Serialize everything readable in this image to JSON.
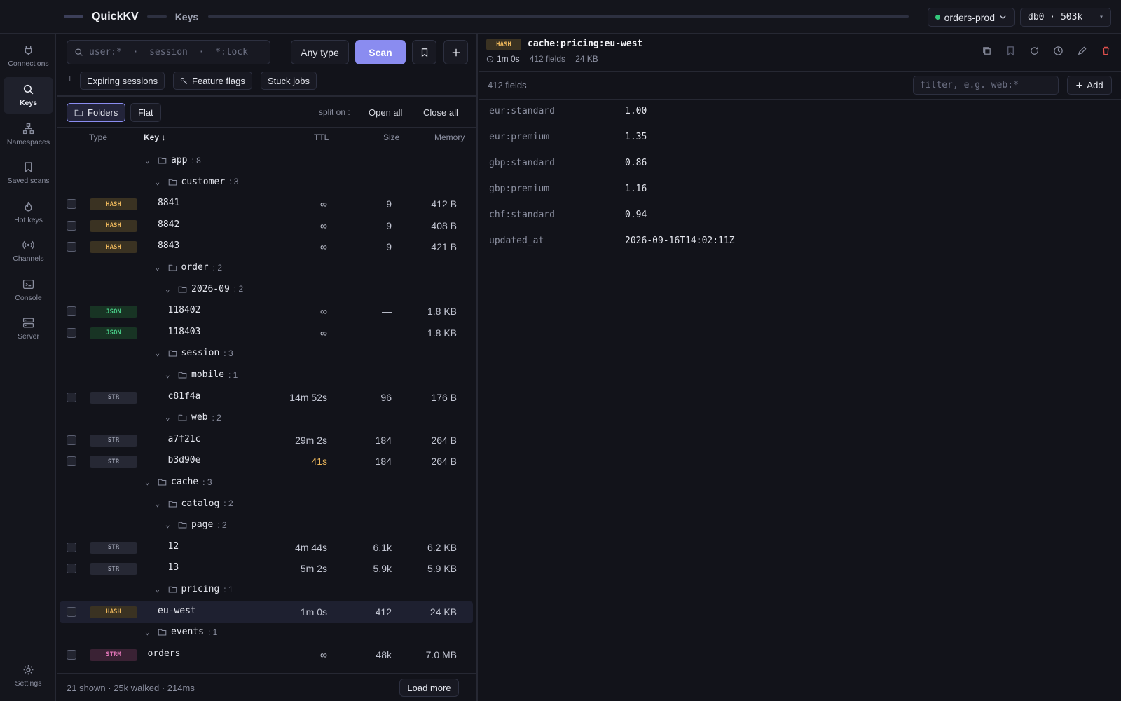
{
  "header": {
    "app_name": "QuickKV",
    "crumb": "Keys",
    "connection": "orders-prod",
    "database": "db0 · 503k"
  },
  "sidebar": {
    "items": [
      {
        "label": "Connections",
        "icon": "plug-icon"
      },
      {
        "label": "Keys",
        "icon": "search-icon",
        "active": true
      },
      {
        "label": "Namespaces",
        "icon": "tree-icon"
      },
      {
        "label": "Saved scans",
        "icon": "bookmark-icon"
      },
      {
        "label": "Hot keys",
        "icon": "flame-icon"
      },
      {
        "label": "Channels",
        "icon": "broadcast-icon"
      },
      {
        "label": "Console",
        "icon": "terminal-icon"
      },
      {
        "label": "Server",
        "icon": "server-icon"
      }
    ],
    "settings_label": "Settings"
  },
  "search": {
    "placeholder": "user:*  ·  session  ·  *:lock",
    "type_filter": "Any type",
    "scan_label": "Scan"
  },
  "presets": [
    "Expiring sessions",
    "Feature flags",
    "Stuck jobs"
  ],
  "view": {
    "folders_label": "Folders",
    "flat_label": "Flat",
    "split_label": "split on :",
    "open_all": "Open all",
    "close_all": "Close all"
  },
  "columns": {
    "type": "Type",
    "key": "Key ↓",
    "ttl": "TTL",
    "size": "Size",
    "memory": "Memory"
  },
  "tree": [
    {
      "kind": "folder",
      "depth": 0,
      "name": "app",
      "count": "8"
    },
    {
      "kind": "folder",
      "depth": 1,
      "name": "customer",
      "count": "3"
    },
    {
      "kind": "key",
      "type": "HASH",
      "depth": 2,
      "name": "8841",
      "ttl": "∞",
      "size": "9",
      "memory": "412 B"
    },
    {
      "kind": "key",
      "type": "HASH",
      "depth": 2,
      "name": "8842",
      "ttl": "∞",
      "size": "9",
      "memory": "408 B"
    },
    {
      "kind": "key",
      "type": "HASH",
      "depth": 2,
      "name": "8843",
      "ttl": "∞",
      "size": "9",
      "memory": "421 B"
    },
    {
      "kind": "folder",
      "depth": 1,
      "name": "order",
      "count": "2"
    },
    {
      "kind": "folder",
      "depth": 2,
      "name": "2026-09",
      "count": "2"
    },
    {
      "kind": "key",
      "type": "JSON",
      "depth": 3,
      "name": "118402",
      "ttl": "∞",
      "size": "—",
      "memory": "1.8 KB"
    },
    {
      "kind": "key",
      "type": "JSON",
      "depth": 3,
      "name": "118403",
      "ttl": "∞",
      "size": "—",
      "memory": "1.8 KB"
    },
    {
      "kind": "folder",
      "depth": 1,
      "name": "session",
      "count": "3"
    },
    {
      "kind": "folder",
      "depth": 2,
      "name": "mobile",
      "count": "1"
    },
    {
      "kind": "key",
      "type": "STR",
      "depth": 3,
      "name": "c81f4a",
      "ttl": "14m 52s",
      "size": "96",
      "memory": "176 B"
    },
    {
      "kind": "folder",
      "depth": 2,
      "name": "web",
      "count": "2"
    },
    {
      "kind": "key",
      "type": "STR",
      "depth": 3,
      "name": "a7f21c",
      "ttl": "29m 2s",
      "size": "184",
      "memory": "264 B"
    },
    {
      "kind": "key",
      "type": "STR",
      "depth": 3,
      "name": "b3d90e",
      "ttl": "41s",
      "size": "184",
      "memory": "264 B",
      "warn": true
    },
    {
      "kind": "folder",
      "depth": 0,
      "name": "cache",
      "count": "3"
    },
    {
      "kind": "folder",
      "depth": 1,
      "name": "catalog",
      "count": "2"
    },
    {
      "kind": "folder",
      "depth": 2,
      "name": "page",
      "count": "2"
    },
    {
      "kind": "key",
      "type": "STR",
      "depth": 3,
      "name": "12",
      "ttl": "4m 44s",
      "size": "6.1k",
      "memory": "6.2 KB"
    },
    {
      "kind": "key",
      "type": "STR",
      "depth": 3,
      "name": "13",
      "ttl": "5m 2s",
      "size": "5.9k",
      "memory": "5.9 KB"
    },
    {
      "kind": "folder",
      "depth": 1,
      "name": "pricing",
      "count": "1"
    },
    {
      "kind": "key",
      "type": "HASH",
      "depth": 2,
      "name": "eu-west",
      "ttl": "1m 0s",
      "size": "412",
      "memory": "24 KB",
      "selected": true
    },
    {
      "kind": "folder",
      "depth": 0,
      "name": "events",
      "count": "1"
    },
    {
      "kind": "key",
      "type": "STRM",
      "depth": 1,
      "name": "orders",
      "ttl": "∞",
      "size": "48k",
      "memory": "7.0 MB"
    }
  ],
  "footer": {
    "status": "21 shown · 25k walked · 214ms",
    "load_more": "Load more"
  },
  "detail": {
    "type": "HASH",
    "key": "cache:pricing:eu-west",
    "ttl": "1m 0s",
    "fields_meta": "412 fields",
    "size_meta": "24 KB",
    "field_count": "412 fields",
    "filter_placeholder": "filter, e.g. web:*",
    "add_label": "Add",
    "fields": [
      {
        "name": "eur:standard",
        "value": "1.00"
      },
      {
        "name": "eur:premium",
        "value": "1.35"
      },
      {
        "name": "gbp:standard",
        "value": "0.86"
      },
      {
        "name": "gbp:premium",
        "value": "1.16"
      },
      {
        "name": "chf:standard",
        "value": "0.94"
      },
      {
        "name": "updated_at",
        "value": "2026-09-16T14:02:11Z"
      }
    ]
  }
}
